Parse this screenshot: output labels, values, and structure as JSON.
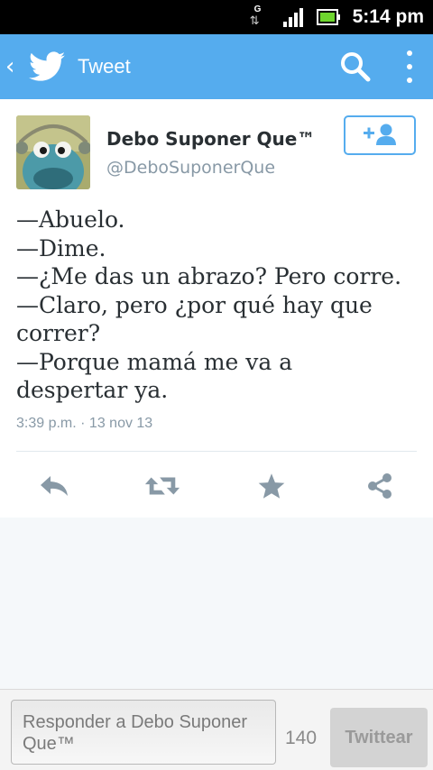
{
  "status_bar": {
    "time": "5:14 pm",
    "network_label": "G",
    "icons": [
      "data-transfer-icon",
      "signal-icon",
      "battery-icon"
    ]
  },
  "action_bar": {
    "title": "Tweet",
    "icons": [
      "back-icon",
      "twitter-bird-icon",
      "search-icon",
      "overflow-menu-icon"
    ],
    "color": "#55acee"
  },
  "tweet": {
    "author_name": "Debo Suponer Que™",
    "author_handle": "@DeboSuponerQue",
    "text_lines": [
      "—Abuelo.",
      "—Dime.",
      "—¿Me das un abrazo? Pero corre.",
      "—Claro, pero ¿por qué hay que",
      "correr?",
      "—Porque mamá me va a",
      "despertar ya."
    ],
    "timestamp": "3:39 p.m. · 13 nov 13",
    "actions": [
      "reply-icon",
      "retweet-icon",
      "favorite-icon",
      "share-icon"
    ]
  },
  "compose": {
    "placeholder": "Responder a Debo Suponer Que™",
    "char_count": "140",
    "submit_label": "Twittear"
  }
}
